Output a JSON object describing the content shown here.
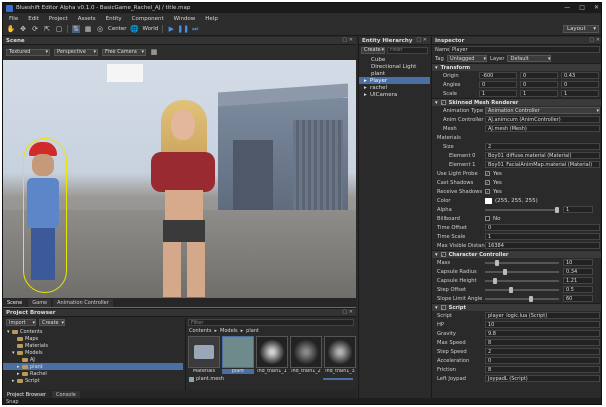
{
  "app": {
    "title": "Blueshift Editor Alpha v0.1.0 - BasicGame_Rachel_AJ / title.map"
  },
  "menu": [
    "File",
    "Edit",
    "Project",
    "Assets",
    "Entity",
    "Component",
    "Window",
    "Help"
  ],
  "toolbar": {
    "center": "Center",
    "world": "World",
    "layout": "Layout"
  },
  "scene": {
    "title": "Scene",
    "render_mode": "Textured",
    "projection": "Perspective",
    "camera": "Free Camera",
    "tabs": [
      "Scene",
      "Game",
      "Animation Controller"
    ]
  },
  "hierarchy": {
    "title": "Entity Hierarchy",
    "create": "Create",
    "filter_placeholder": "Filter",
    "items": [
      "Cube",
      "Directional Light",
      "plant",
      "Player",
      "rachel",
      "UICamera"
    ]
  },
  "inspector": {
    "title": "Inspector",
    "name_label": "Name",
    "name": "Player",
    "tag_label": "Tag",
    "tag": "Untagged",
    "layer_label": "Layer",
    "layer": "Default",
    "transform": {
      "title": "Transform",
      "origin_label": "Origin",
      "origin": [
        "-600",
        "0",
        "0.43"
      ],
      "angles_label": "Angles",
      "angles": [
        "0",
        "0",
        "0"
      ],
      "scale_label": "Scale",
      "scale": [
        "1",
        "1",
        "1"
      ]
    },
    "skinned": {
      "title": "Skinned Mesh Renderer",
      "anim_type_label": "Animation Type",
      "anim_type": "Animation Controller",
      "anim_ctrl_label": "Anim Controller",
      "anim_ctrl": "AJ.animcum (AnimController)",
      "mesh_label": "Mesh",
      "mesh": "AJ.mesh (Mesh)",
      "materials_label": "Materials",
      "size_label": "Size",
      "size": "2",
      "el0_label": "Element 0",
      "el0": "Boy01_diffuse.material (Material)",
      "el1_label": "Element 1",
      "el1": "Boy01_FacialAnimMap.material (Material)",
      "lp_label": "Use Light Probe",
      "lp": "Yes",
      "cs_label": "Cast Shadows",
      "cs": "Yes",
      "rs_label": "Receive Shadows",
      "rs": "Yes",
      "color_label": "Color",
      "color": "(255, 255, 255)",
      "alpha_label": "Alpha",
      "alpha": "1",
      "bb_label": "Billboard",
      "bb": "No",
      "to_label": "Time Offset",
      "to": "0",
      "ts_label": "Time Scale",
      "ts": "1",
      "mvd_label": "Max Visible Distance",
      "mvd": "16384"
    },
    "controller": {
      "title": "Character Controller",
      "mass_label": "Mass",
      "mass": "10",
      "radius_label": "Capsule Radius",
      "radius": "0.34",
      "height_label": "Capsule Height",
      "height": "1.21",
      "step_label": "Step Offset",
      "step": "0.5",
      "slope_label": "Slope Limit Angle",
      "slope": "60"
    },
    "script": {
      "title": "Script",
      "script_label": "Script",
      "script": "player_logic.lua (Script)",
      "hp_label": "HP",
      "hp": "10",
      "gravity_label": "Gravity",
      "gravity": "9.8",
      "maxspeed_label": "Max Speed",
      "maxspeed": "8",
      "stepspeed_label": "Step Speed",
      "stepspeed": "2",
      "accel_label": "Acceleration",
      "accel": "0",
      "friction_label": "Friction",
      "friction": "8",
      "joypad_label": "Left Joypad",
      "joypad": "JoypadL (Script)"
    }
  },
  "project": {
    "title": "Project Browser",
    "import": "Import",
    "create": "Create",
    "filter_placeholder": "Filter",
    "tree": [
      "Contents",
      "Maps",
      "Materials",
      "Models",
      "AJ",
      "plant",
      "Rachel",
      "Script"
    ],
    "breadcrumb": [
      "Contents",
      "Models",
      "plant"
    ],
    "assets": [
      "Materials",
      "plant",
      "ind_train1_1",
      "ind_train1_2",
      "ind_train1_3"
    ],
    "selected_file": "plant.mesh",
    "tabs": [
      "Project Browser",
      "Console"
    ]
  },
  "status": "Snap",
  "colors": {
    "accent": "#4a6fa5",
    "panel": "#2a2a2a",
    "header": "#333333"
  }
}
